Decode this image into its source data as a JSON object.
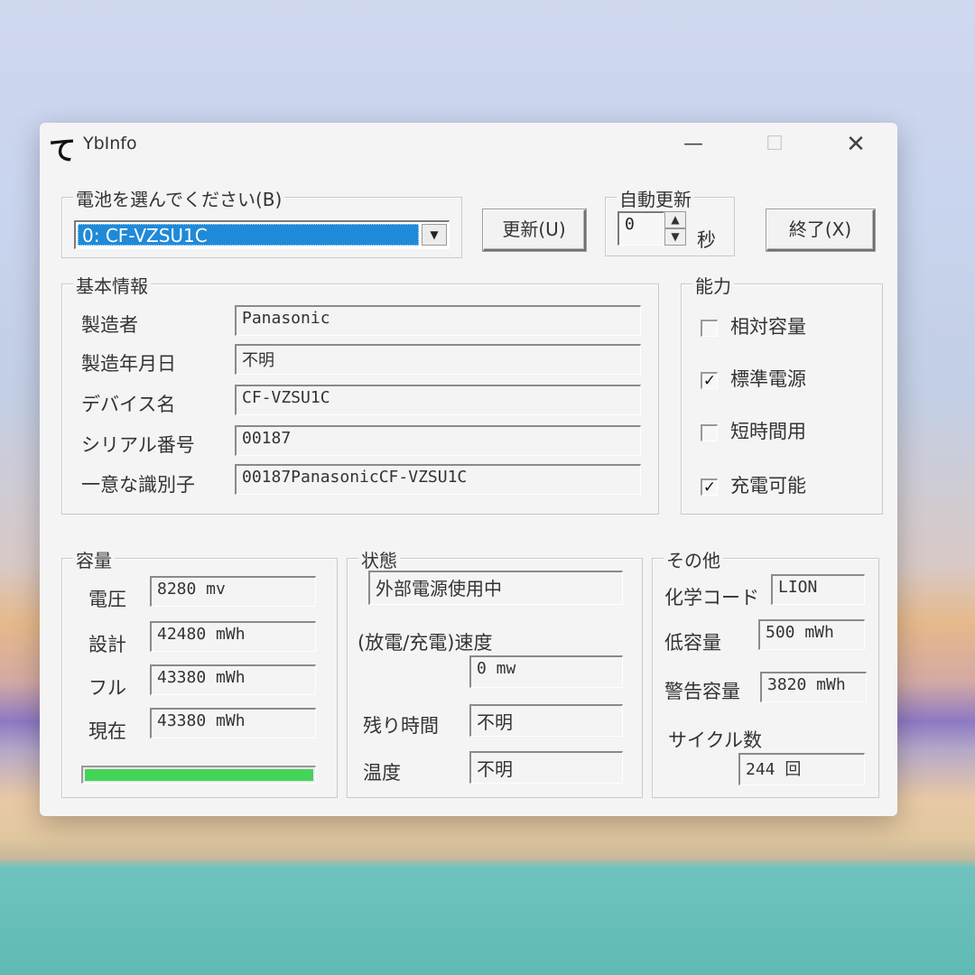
{
  "window": {
    "title": "YbInfo",
    "icon_glyph": "て",
    "minimize_glyph": "—",
    "maximize_glyph": "☐",
    "close_glyph": "✕"
  },
  "battery_select": {
    "legend": "電池を選んでください(B)",
    "selected": "0: CF-VZSU1C",
    "arrow_glyph": "▼"
  },
  "refresh_button": {
    "label": "更新(U)"
  },
  "auto_refresh": {
    "legend": "自動更新",
    "value": "0",
    "unit": "秒",
    "up_glyph": "▲",
    "down_glyph": "▼"
  },
  "exit_button": {
    "label": "終了(X)"
  },
  "basic_info": {
    "legend": "基本情報",
    "rows": [
      {
        "label": "製造者",
        "value": "Panasonic"
      },
      {
        "label": "製造年月日",
        "value": "不明"
      },
      {
        "label": "デバイス名",
        "value": "CF-VZSU1C"
      },
      {
        "label": "シリアル番号",
        "value": "00187"
      },
      {
        "label": "一意な識別子",
        "value": "00187PanasonicCF-VZSU1C"
      }
    ]
  },
  "capability": {
    "legend": "能力",
    "items": [
      {
        "label": "相対容量",
        "checked": false,
        "mark": ""
      },
      {
        "label": "標準電源",
        "checked": true,
        "mark": "✓"
      },
      {
        "label": "短時間用",
        "checked": false,
        "mark": ""
      },
      {
        "label": "充電可能",
        "checked": true,
        "mark": "✓"
      }
    ]
  },
  "capacity": {
    "legend": "容量",
    "rows": [
      {
        "label": "電圧",
        "value": "8280 mv"
      },
      {
        "label": "設計",
        "value": "42480 mWh"
      },
      {
        "label": "フル",
        "value": "43380 mWh"
      },
      {
        "label": "現在",
        "value": "43380 mWh"
      }
    ],
    "progress_fraction": 1.0,
    "progress_color": "#43d45a"
  },
  "status": {
    "legend": "状態",
    "power_state": "外部電源使用中",
    "rate_label": "(放電/充電)速度",
    "rate_value": "0 mw",
    "remaining_label": "残り時間",
    "remaining_value": "不明",
    "temp_label": "温度",
    "temp_value": "不明"
  },
  "other": {
    "legend": "その他",
    "chem_label": "化学コード",
    "chem_value": "LION",
    "low_label": "低容量",
    "low_value": "500 mWh",
    "warn_label": "警告容量",
    "warn_value": "3820 mWh",
    "cycle_label": "サイクル数",
    "cycle_value": "244 回"
  },
  "colors": {
    "selection": "#1f8ad8",
    "progress": "#43d45a",
    "window_bg": "#f4f4f4"
  }
}
